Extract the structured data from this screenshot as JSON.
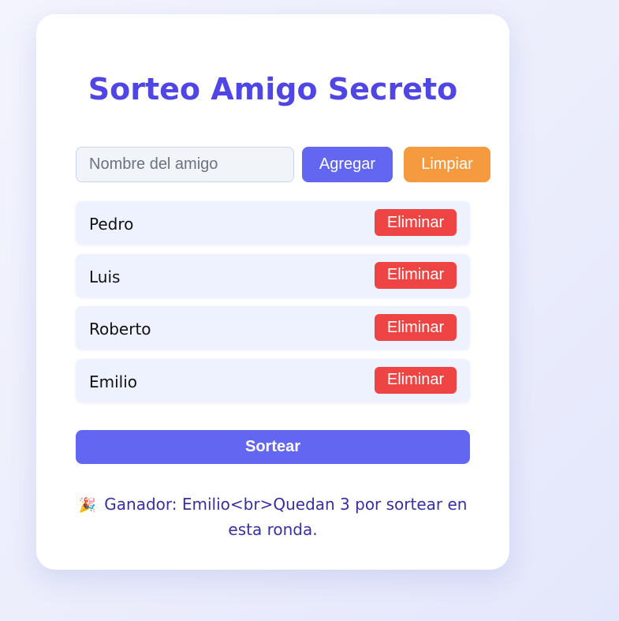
{
  "app": {
    "title": "Sorteo Amigo Secreto"
  },
  "form": {
    "input_placeholder": "Nombre del amigo",
    "input_value": "",
    "add_label": "Agregar",
    "clear_label": "Limpiar"
  },
  "friends": [
    {
      "name": "Pedro",
      "delete_label": "Eliminar"
    },
    {
      "name": "Luis",
      "delete_label": "Eliminar"
    },
    {
      "name": "Roberto",
      "delete_label": "Eliminar"
    },
    {
      "name": "Emilio",
      "delete_label": "Eliminar"
    }
  ],
  "draw": {
    "label": "Sortear"
  },
  "result": {
    "emoji": "🎉",
    "text": "Ganador: Emilio<br>Quedan 3 por sortear en esta ronda."
  },
  "colors": {
    "accent": "#6366f1",
    "title": "#4f46e5",
    "clear": "#f59a3e",
    "delete": "#ef4444",
    "result_text": "#3730a3"
  },
  "icons": {
    "result_icon": "party-popper-icon"
  }
}
